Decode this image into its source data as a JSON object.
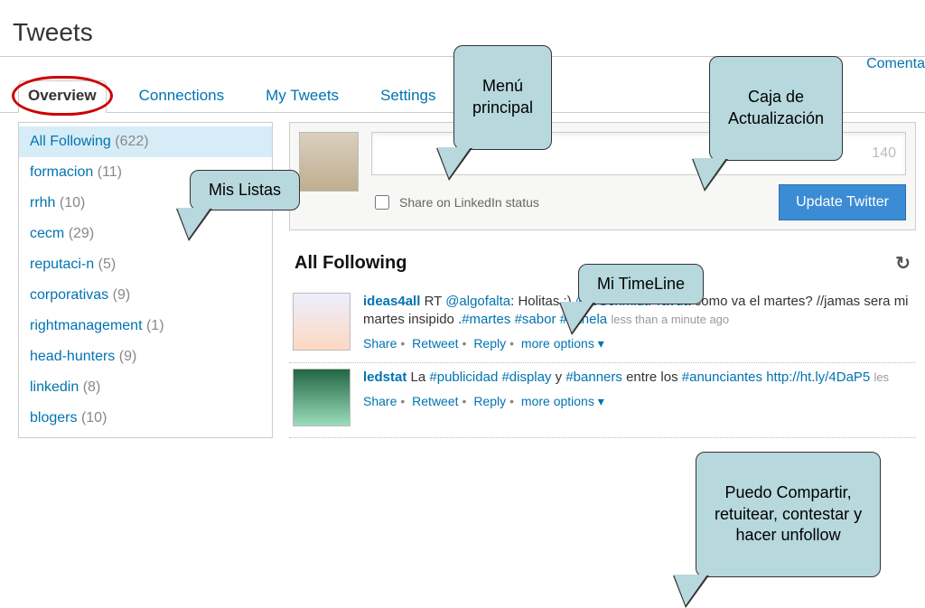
{
  "page_title": "Tweets",
  "top_link": "Comenta",
  "tabs": [
    {
      "label": "Overview",
      "active": true
    },
    {
      "label": "Connections"
    },
    {
      "label": "My Tweets"
    },
    {
      "label": "Settings"
    }
  ],
  "sidebar": {
    "items": [
      {
        "name": "All Following",
        "count": "(622)",
        "selected": true
      },
      {
        "name": "formacion",
        "count": "(11)"
      },
      {
        "name": "rrhh",
        "count": "(10)"
      },
      {
        "name": "cecm",
        "count": "(29)"
      },
      {
        "name": "reputaci-n",
        "count": "(5)"
      },
      {
        "name": "corporativas",
        "count": "(9)"
      },
      {
        "name": "rightmanagement",
        "count": "(1)"
      },
      {
        "name": "head-hunters",
        "count": "(9)"
      },
      {
        "name": "linkedin",
        "count": "(8)"
      },
      {
        "name": "blogers",
        "count": "(10)"
      }
    ]
  },
  "update_box": {
    "char_count": "140",
    "share_label": "Share on LinkedIn status",
    "button_label": "Update Twitter"
  },
  "timeline": {
    "header": "All Following",
    "tweets": [
      {
        "author": "ideas4all",
        "body_prefix": "RT ",
        "mention": "@algofalta",
        "body_mid": ": Holitas :) ",
        "mention2": "@CSchmidtPravda",
        "body_after": " como va el martes? //jamas sera mi martes insipido .",
        "hashtags": "#martes #sabor #canela",
        "time": "less than a minute ago",
        "actions": [
          "Share",
          "Retweet",
          "Reply",
          "more options ▾"
        ]
      },
      {
        "author": "ledstat",
        "body_prefix": "La ",
        "hashtags1": "#publicidad #display",
        "body_mid": " y ",
        "hashtags2": "#banners",
        "body_after": " entre los ",
        "hashtags3": "#anunciantes",
        "link": " http://ht.ly/4DaP5",
        "time": "les",
        "actions": [
          "Share",
          "Retweet",
          "Reply",
          "more options ▾"
        ]
      }
    ]
  },
  "callouts": {
    "menu": "Menú\nprincipal",
    "caja": "Caja de\nActualización",
    "mislistas": "Mis Listas",
    "timeline": "Mi TimeLine",
    "actions": "Puedo Compartir,\nretuitear, contestar y\nhacer unfollow"
  }
}
